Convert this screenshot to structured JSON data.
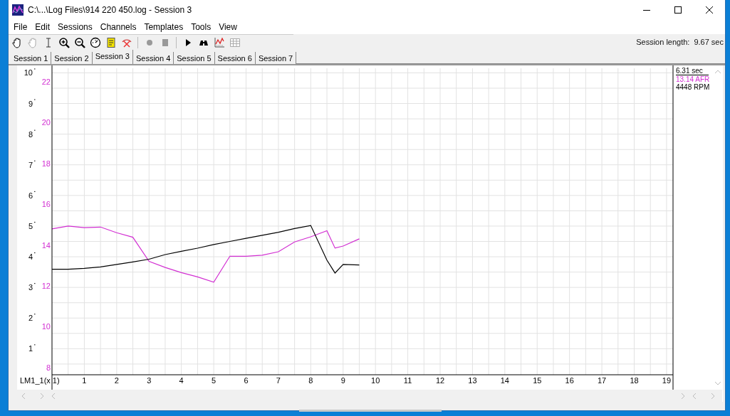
{
  "window": {
    "title": "C:\\...\\Log Files\\914 220 450.log - Session 3"
  },
  "menu": [
    "File",
    "Edit",
    "Sessions",
    "Channels",
    "Templates",
    "Tools",
    "View"
  ],
  "toolbar": [
    {
      "kind": "hand",
      "disabled": false
    },
    {
      "kind": "hand",
      "disabled": true
    },
    {
      "kind": "cursor",
      "disabled": false
    },
    {
      "kind": "zoom-in",
      "disabled": false
    },
    {
      "kind": "zoom-out",
      "disabled": false
    },
    {
      "kind": "gauge",
      "disabled": false
    },
    {
      "kind": "notepad",
      "disabled": false
    },
    {
      "kind": "cross",
      "disabled": false
    },
    {
      "kind": "separator"
    },
    {
      "kind": "record",
      "disabled": true
    },
    {
      "kind": "stop",
      "disabled": true
    },
    {
      "kind": "separator"
    },
    {
      "kind": "play",
      "disabled": false
    },
    {
      "kind": "binoculars",
      "disabled": false
    },
    {
      "kind": "chart",
      "disabled": false
    },
    {
      "kind": "grid",
      "disabled": true
    }
  ],
  "session_length": {
    "label": "Session length:",
    "value": "9.67 sec"
  },
  "tabs": [
    {
      "label": "Session 1",
      "selected": false
    },
    {
      "label": "Session 2",
      "selected": false
    },
    {
      "label": "Session 3",
      "selected": true
    },
    {
      "label": "Session 4",
      "selected": false
    },
    {
      "label": "Session 5",
      "selected": false
    },
    {
      "label": "Session 6",
      "selected": false
    },
    {
      "label": "Session 7",
      "selected": false
    }
  ],
  "readout": {
    "time": "6.31 sec",
    "values": [
      {
        "text": "13.14 AFR",
        "color": "#d22fd2"
      },
      {
        "text": "4448 RPM",
        "color": "#000000"
      }
    ]
  },
  "chart_data": {
    "type": "line",
    "xlabel": "LM1_1(x 1)",
    "x": [
      0,
      0.5,
      1,
      1.5,
      2,
      2.5,
      3,
      3.5,
      4,
      4.5,
      5,
      5.5,
      6,
      6.5,
      7,
      7.5,
      8,
      8.5,
      8.75,
      9,
      9.5
    ],
    "xlim": [
      0,
      19.2
    ],
    "grid": true,
    "xticks": [
      1,
      2,
      3,
      4,
      5,
      6,
      7,
      8,
      9,
      10,
      11,
      12,
      13,
      14,
      15,
      16,
      17,
      18,
      19
    ],
    "ylim": [
      0.15,
      10.15
    ],
    "yticks": [
      1,
      2,
      3,
      4,
      5,
      6,
      7,
      8,
      9,
      10
    ],
    "y2lim": [
      7.65,
      22.65
    ],
    "y2ticks": [
      8,
      10,
      12,
      14,
      16,
      18,
      20,
      22
    ],
    "series": [
      {
        "color": "#d22fd2",
        "axis": "y2",
        "values": [
          14.79,
          14.93,
          14.85,
          14.88,
          14.6,
          14.38,
          13.2,
          12.9,
          12.65,
          12.44,
          12.18,
          13.45,
          13.45,
          13.5,
          13.67,
          14.15,
          14.4,
          14.7,
          13.85,
          13.95,
          14.3
        ]
      },
      {
        "color": "#000000",
        "values": [
          3.59,
          3.59,
          3.62,
          3.67,
          3.75,
          3.83,
          3.92,
          4.07,
          4.18,
          4.28,
          4.4,
          4.5,
          4.6,
          4.7,
          4.8,
          4.92,
          5.02,
          3.89,
          3.47,
          3.75,
          3.73
        ]
      }
    ]
  }
}
